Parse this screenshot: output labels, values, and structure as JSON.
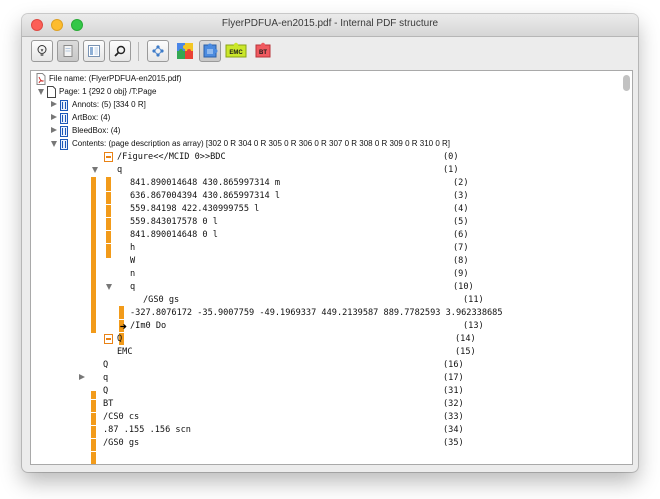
{
  "window": {
    "title": "FlyerPDFUA-en2015.pdf - Internal PDF structure"
  },
  "toolbar": {
    "buttons": [
      {
        "id": "lightbulb",
        "icon": "lightbulb-icon"
      },
      {
        "id": "page",
        "icon": "page-view-icon"
      },
      {
        "id": "split",
        "icon": "split-view-icon"
      },
      {
        "id": "search",
        "icon": "search-icon"
      },
      {
        "id": "nodes",
        "icon": "structure-nodes-icon"
      },
      {
        "id": "puzzle-multi",
        "icon": "puzzle-multicolor-icon"
      },
      {
        "id": "puzzle-blue",
        "icon": "puzzle-blue-icon"
      },
      {
        "id": "emc",
        "icon": "emc-puzzle-icon",
        "text": "EMC"
      },
      {
        "id": "bt",
        "icon": "bt-puzzle-icon",
        "text": "BT"
      }
    ]
  },
  "tree": {
    "file_label": "File name: (FlyerPDFUA-en2015.pdf)",
    "page_label": "Page: 1  {292 0 obj}      /T:Page",
    "annots_label": "Annots:  (5) [334 0 R]",
    "artbox_label": "ArtBox:  (4)",
    "bleedbox_label": "BleedBox:  (4)",
    "contents_label": "Contents: (page description as array)  [302 0 R  304 0 R  305 0 R  306 0 R  307 0 R  308 0 R  309 0 R  310 0 R]",
    "ops": [
      {
        "text": "/Figure<</MCID 0>>BDC",
        "index": "(0)"
      },
      {
        "text": "q",
        "index": "(1)"
      },
      {
        "text": "841.890014648 430.865997314 m",
        "index": "(2)"
      },
      {
        "text": "636.867004394 430.865997314 l",
        "index": "(3)"
      },
      {
        "text": "559.84198 422.430999755 l",
        "index": "(4)"
      },
      {
        "text": "559.843017578 0 l",
        "index": "(5)"
      },
      {
        "text": "841.890014648 0 l",
        "index": "(6)"
      },
      {
        "text": "h",
        "index": "(7)"
      },
      {
        "text": "W",
        "index": "(8)"
      },
      {
        "text": "n",
        "index": "(9)"
      },
      {
        "text": "q",
        "index": "(10)"
      },
      {
        "text": "/GS0 gs",
        "index": "(11)"
      },
      {
        "text": "-327.8076172 -35.9007759 -49.1969337 449.2139587 889.7782593 3.962338685",
        "index": "(12)"
      },
      {
        "text": "/Im0 Do",
        "index": "(13)"
      },
      {
        "text": "Q",
        "index": "(14)"
      },
      {
        "text": "EMC",
        "index": "(15)"
      },
      {
        "text": "Q",
        "index": "(16)"
      },
      {
        "text": "q",
        "index": "(17)"
      },
      {
        "text": "Q",
        "index": "(31)"
      },
      {
        "text": "BT",
        "index": "(32)"
      },
      {
        "text": "/CS0 cs",
        "index": "(33)"
      },
      {
        "text": ".87 .155 .156 scn",
        "index": "(34)"
      },
      {
        "text": "/GS0 gs",
        "index": "(35)"
      }
    ]
  },
  "colors": {
    "accent_orange": "#f29b1a",
    "bracket_blue": "#1c58b8"
  }
}
